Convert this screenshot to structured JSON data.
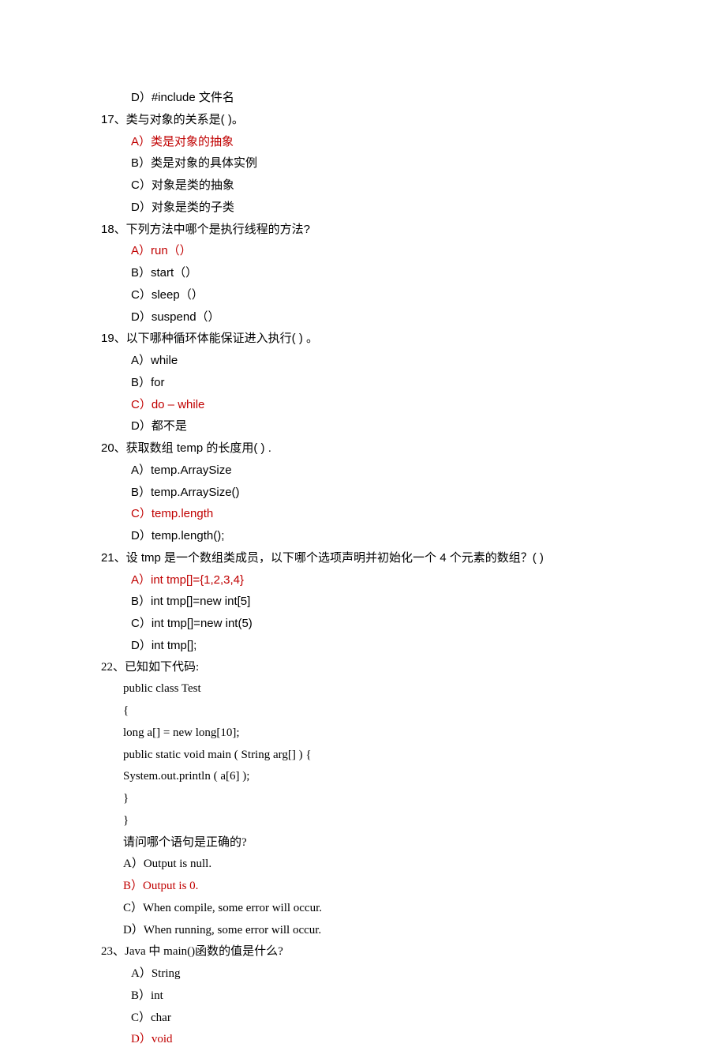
{
  "q16": {
    "optD": "D）#include  文件名"
  },
  "q17": {
    "stem": "17、类与对象的关系是( )。",
    "optA": "A）类是对象的抽象",
    "optB": "B）类是对象的具体实例",
    "optC": "C）对象是类的抽象",
    "optD": "D）对象是类的子类"
  },
  "q18": {
    "stem": "18、下列方法中哪个是执行线程的方法?",
    "optA": "A）run（）",
    "optB": "B）start（）",
    "optC": "C）sleep（）",
    "optD": "D）suspend（）"
  },
  "q19": {
    "stem": "19、以下哪种循环体能保证进入执行( ) 。",
    "optA": "A）while",
    "optB": "B）for",
    "optC": "C）do – while",
    "optD": "D）都不是"
  },
  "q20": {
    "stem": "20、获取数组 temp 的长度用( ) .",
    "optA": "A）temp.ArraySize",
    "optB": "B）temp.ArraySize()",
    "optC": "C）temp.length",
    "optD": "D）temp.length();"
  },
  "q21": {
    "stem": "21、设 tmp 是一个数组类成员，以下哪个选项声明并初始化一个 4 个元素的数组？( )",
    "optA": "A）int tmp[]={1,2,3,4}",
    "optB": "B）int tmp[]=new int[5]",
    "optC": "C）int tmp[]=new int(5)",
    "optD": "D）int tmp[];"
  },
  "q22": {
    "stem": "22、已知如下代码:",
    "c1": "public class Test",
    "c2": "{",
    "c3": "long a[] = new long[10];",
    "c4": "public static void main ( String arg[] ) {",
    "c5": "System.out.println ( a[6] );",
    "c6": "}",
    "c7": "}",
    "ask": "请问哪个语句是正确的?",
    "optA": "A）Output is null.",
    "optB": "B）Output is 0.",
    "optC": "C）When compile, some error will occur.",
    "optD": "D）When running, some error will occur."
  },
  "q23": {
    "stem": "23、Java 中 main()函数的值是什么?",
    "optA": "A）String",
    "optB": "B）int",
    "optC": "C）char",
    "optD": "D）void"
  }
}
